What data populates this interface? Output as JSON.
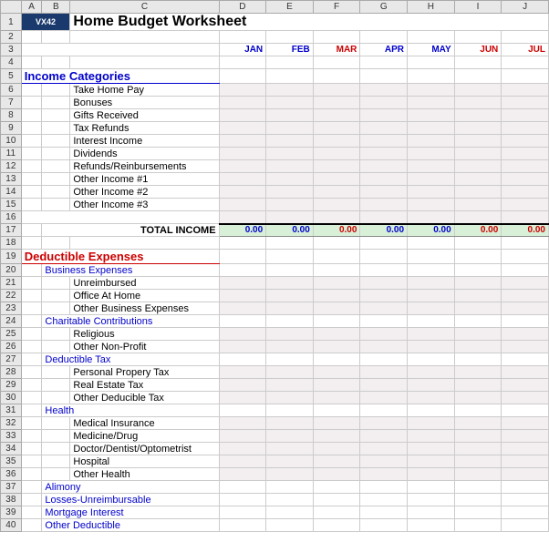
{
  "colHeaders": [
    "A",
    "B",
    "C",
    "D",
    "E",
    "F",
    "G",
    "H",
    "I",
    "J"
  ],
  "logo": "VX42",
  "title": "Home Budget Worksheet",
  "months": [
    {
      "label": "JAN",
      "cls": "month-blue"
    },
    {
      "label": "FEB",
      "cls": "month-blue"
    },
    {
      "label": "MAR",
      "cls": "month-red"
    },
    {
      "label": "APR",
      "cls": "month-blue"
    },
    {
      "label": "MAY",
      "cls": "month-blue"
    },
    {
      "label": "JUN",
      "cls": "month-red"
    },
    {
      "label": "JUL",
      "cls": "month-red"
    }
  ],
  "incomeHeader": "Income Categories",
  "incomeItems": [
    "Take Home Pay",
    "Bonuses",
    "Gifts Received",
    "Tax Refunds",
    "Interest Income",
    "Dividends",
    "Refunds/Reinbursements",
    "Other Income #1",
    "Other Income #2",
    "Other Income #3"
  ],
  "totalIncomeLabel": "TOTAL INCOME",
  "totalValues": [
    {
      "val": "0.00",
      "cls": "total-blue"
    },
    {
      "val": "0.00",
      "cls": "total-blue"
    },
    {
      "val": "0.00",
      "cls": "total-red"
    },
    {
      "val": "0.00",
      "cls": "total-blue"
    },
    {
      "val": "0.00",
      "cls": "total-blue"
    },
    {
      "val": "0.00",
      "cls": "total-red"
    },
    {
      "val": "0.00",
      "cls": "total-red"
    }
  ],
  "expensesHeader": "Deductible Expenses",
  "expenseGroups": [
    {
      "sub": "Business Expenses",
      "items": [
        "Unreimbursed",
        "Office At Home",
        "Other Business Expenses"
      ]
    },
    {
      "sub": "Charitable Contributions",
      "items": [
        "Religious",
        "Other Non-Profit"
      ]
    },
    {
      "sub": "Deductible Tax",
      "items": [
        "Personal Propery Tax",
        "Real Estate Tax",
        "Other Deducible Tax"
      ]
    },
    {
      "sub": "Health",
      "items": [
        "Medical Insurance",
        "Medicine/Drug",
        "Doctor/Dentist/Optometrist",
        "Hospital",
        "Other Health"
      ]
    }
  ],
  "expenseStandalone": [
    "Alimony",
    "Losses-Unreimbursable",
    "Mortgage Interest",
    "Other Deductible"
  ]
}
